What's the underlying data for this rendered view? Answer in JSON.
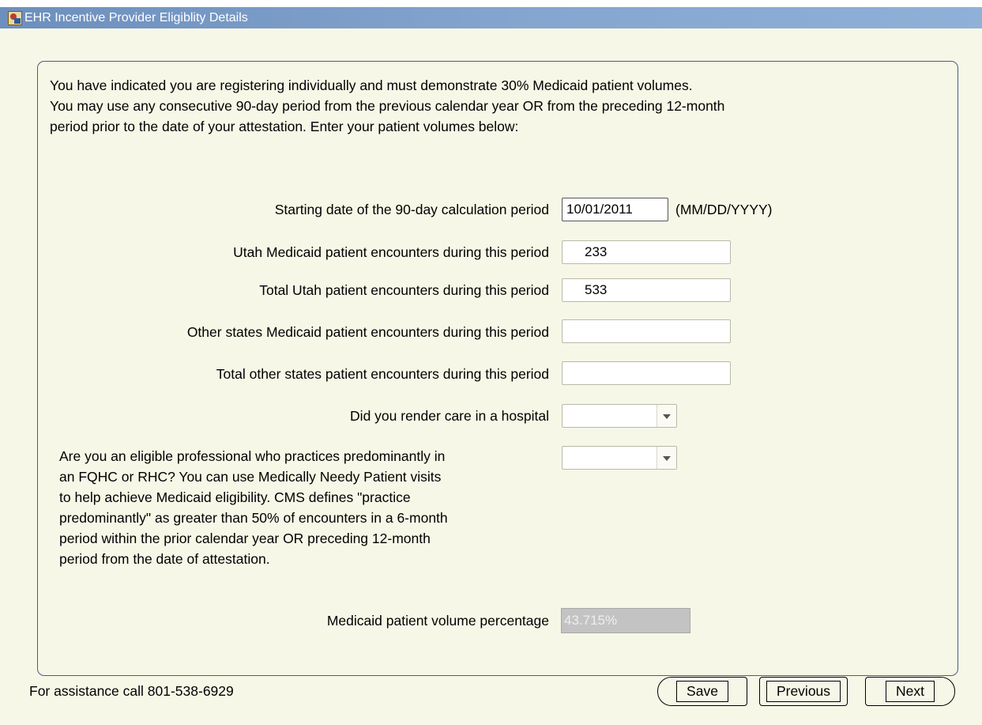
{
  "window": {
    "title": "EHR Incentive Provider Eligiblity Details",
    "icon": "app-icon"
  },
  "intro": {
    "line1": "You have indicated you are registering individually and must demonstrate 30% Medicaid patient volumes.",
    "line2": "You may use any consecutive 90-day period from the previous calendar year OR from the preceding 12-month",
    "line3": "period prior to the date of your attestation.  Enter your patient volumes below:"
  },
  "form": {
    "start_date": {
      "label": "Starting date of the 90-day calculation period",
      "value": "10/01/2011",
      "hint": "(MM/DD/YYYY)"
    },
    "utah_medicaid": {
      "label": "Utah Medicaid patient encounters during this period",
      "value": "233"
    },
    "total_utah": {
      "label": "Total Utah patient encounters during this period",
      "value": "533"
    },
    "other_medicaid": {
      "label": "Other states Medicaid patient encounters during this period",
      "value": ""
    },
    "total_other": {
      "label": "Total other states patient encounters during this period",
      "value": ""
    },
    "hospital": {
      "label": "Did you render care in a hospital",
      "value": ""
    },
    "fqhc": {
      "label_lines": [
        "Are you an eligible professional who practices predominantly in",
        "an FQHC or RHC? You can use Medically Needy Patient visits",
        "to help achieve Medicaid eligibility. CMS defines \"practice",
        "predominantly\" as greater than 50% of encounters in a 6-month",
        "period within the prior calendar year OR preceding 12-month",
        "period from the date of attestation."
      ],
      "value": ""
    },
    "percentage": {
      "label": "Medicaid patient volume percentage",
      "value": "43.715%"
    }
  },
  "footer": {
    "assistance": "For assistance call 801-538-6929",
    "save": "Save",
    "previous": "Previous",
    "next": "Next"
  }
}
